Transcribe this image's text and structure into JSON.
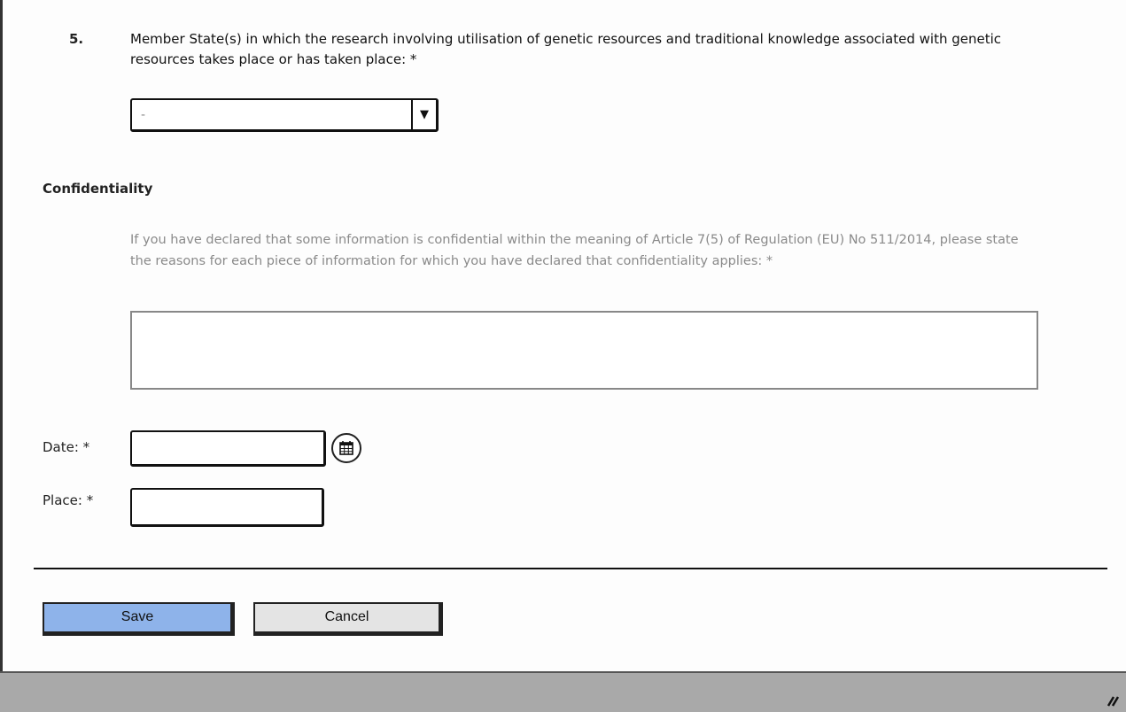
{
  "question": {
    "number": "5.",
    "text": "Member State(s) in which the research involving utilisation of genetic resources and traditional knowledge associated with genetic resources takes place or has taken place: *",
    "select_value": "-"
  },
  "confidentiality": {
    "title": "Confidentiality",
    "label": "If you have declared that some information is confidential within the meaning of Article 7(5) of Regulation (EU) No 511/2014, please state the reasons for each piece of information for which you have declared that confidentiality applies: *",
    "value": ""
  },
  "date": {
    "label": "Date: *",
    "value": ""
  },
  "place": {
    "label": "Place: *",
    "value": ""
  },
  "buttons": {
    "save": "Save",
    "cancel": "Cancel"
  },
  "icons": {
    "dropdown": "chevron-down-icon",
    "calendar": "calendar-icon",
    "resize": "resize-grip-icon"
  },
  "colors": {
    "save_button": "#8eb3ea",
    "cancel_button": "#e4e4e4",
    "status_bar": "#a9a9a9"
  }
}
